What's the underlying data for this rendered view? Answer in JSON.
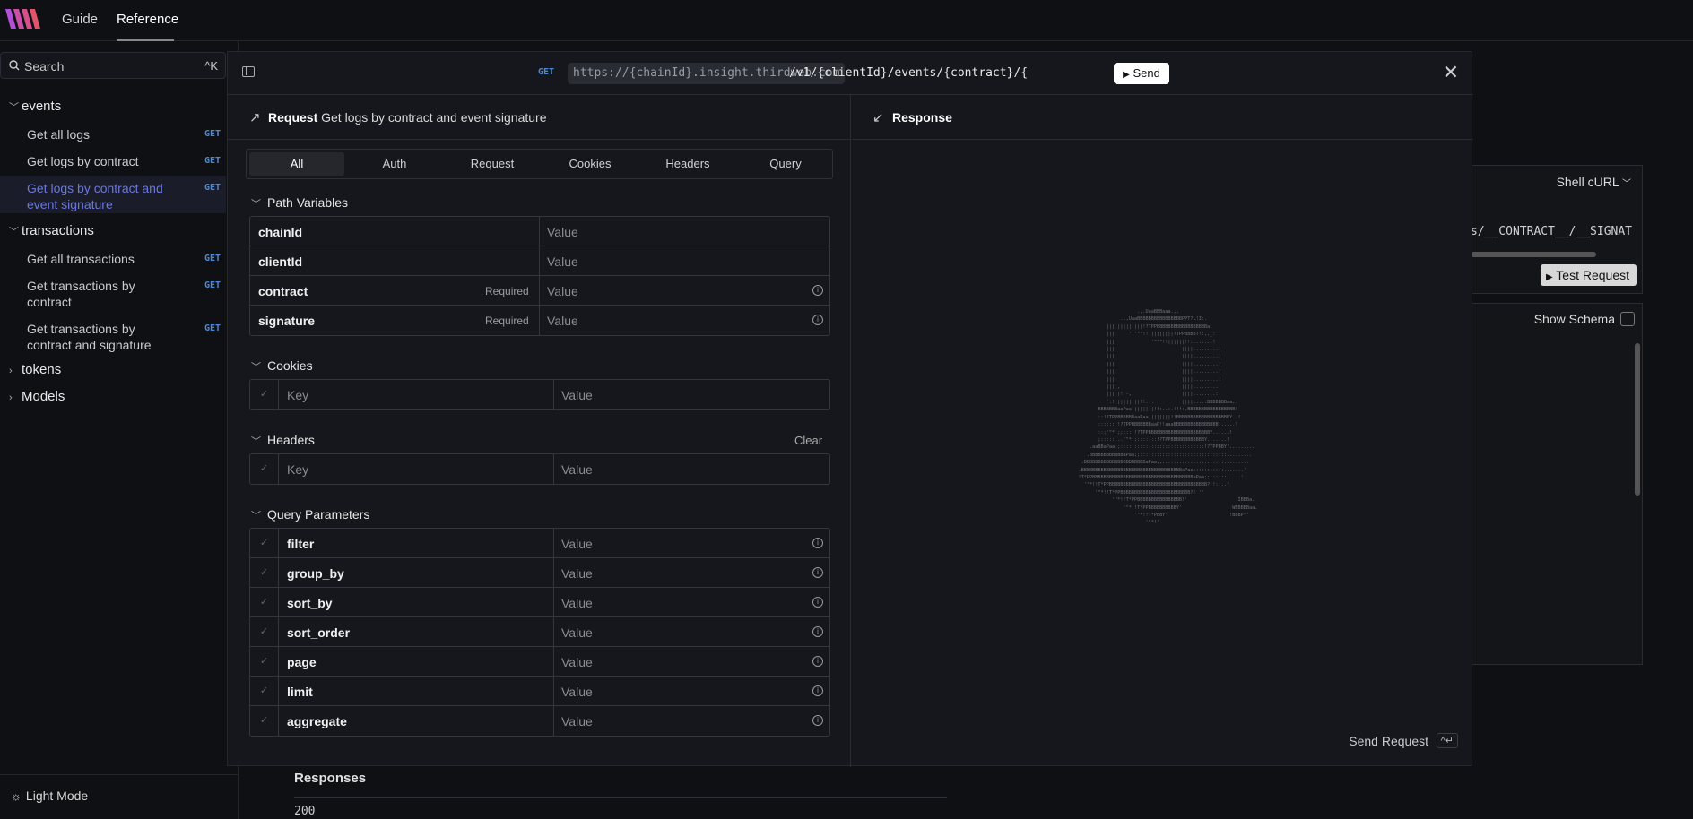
{
  "nav": {
    "guide": "Guide",
    "reference": "Reference"
  },
  "sidebar": {
    "search_label": "Search",
    "search_shortcut": "^K",
    "groups": [
      {
        "label": "events",
        "expanded": true
      },
      {
        "label": "transactions",
        "expanded": true
      },
      {
        "label": "tokens",
        "expanded": false
      },
      {
        "label": "Models",
        "expanded": false
      }
    ],
    "items": [
      {
        "label": "Get all logs",
        "method": "GET"
      },
      {
        "label": "Get logs by contract",
        "method": "GET"
      },
      {
        "label": "Get logs by contract and",
        "label2": "event signature",
        "method": "GET"
      },
      {
        "label": "Get all transactions",
        "method": "GET"
      },
      {
        "label": "Get transactions by",
        "label2": "contract",
        "method": "GET"
      },
      {
        "label": "Get transactions by",
        "label2": "contract and signature",
        "method": "GET"
      }
    ],
    "light_mode": "Light Mode"
  },
  "background": {
    "shell_label": "Shell cURL",
    "code_snippet": "s/__CONTRACT__/__SIGNAT",
    "test_request": "Test Request",
    "show_schema": "Show Schema",
    "responses": "Responses",
    "status": "200"
  },
  "modal": {
    "method": "GET",
    "url_base": "https://{chainId}.insight.thirdweb.com",
    "url_path": "/v1/{clientId}/events/{contract}/{",
    "send": "Send",
    "request_label": "Request",
    "request_title": "Get logs by contract and event signature",
    "tabs": [
      "All",
      "Auth",
      "Request",
      "Cookies",
      "Headers",
      "Query"
    ],
    "path_variables_title": "Path Variables",
    "path_variables": [
      {
        "name": "chainId",
        "required": "",
        "placeholder": "Value"
      },
      {
        "name": "clientId",
        "required": "",
        "placeholder": "Value"
      },
      {
        "name": "contract",
        "required": "Required",
        "placeholder": "Value"
      },
      {
        "name": "signature",
        "required": "Required",
        "placeholder": "Value"
      }
    ],
    "cookies_title": "Cookies",
    "cookies_row": {
      "key": "Key",
      "value": "Value"
    },
    "headers_title": "Headers",
    "headers_clear": "Clear",
    "headers_row": {
      "key": "Key",
      "value": "Value"
    },
    "query_title": "Query Parameters",
    "query_params": [
      {
        "name": "filter",
        "placeholder": "Value"
      },
      {
        "name": "group_by",
        "placeholder": "Value"
      },
      {
        "name": "sort_by",
        "placeholder": "Value"
      },
      {
        "name": "sort_order",
        "placeholder": "Value"
      },
      {
        "name": "page",
        "placeholder": "Value"
      },
      {
        "name": "limit",
        "placeholder": "Value"
      },
      {
        "name": "aggregate",
        "placeholder": "Value"
      }
    ],
    "response_label": "Response",
    "send_request": "Send Request",
    "send_request_kbd": "^↵"
  },
  "colors": {
    "accent": "#6b78d8",
    "method": "#4b8ad6",
    "background": "#0f1014",
    "panel": "#16171c"
  },
  "icons": [
    "logo-icon",
    "search-icon",
    "sun-icon",
    "sidebar-toggle-icon",
    "play-icon",
    "close-icon",
    "arrow-up-right-icon",
    "arrow-down-left-icon",
    "info-icon",
    "check-icon",
    "chevron-down-icon",
    "chevron-right-icon"
  ]
}
